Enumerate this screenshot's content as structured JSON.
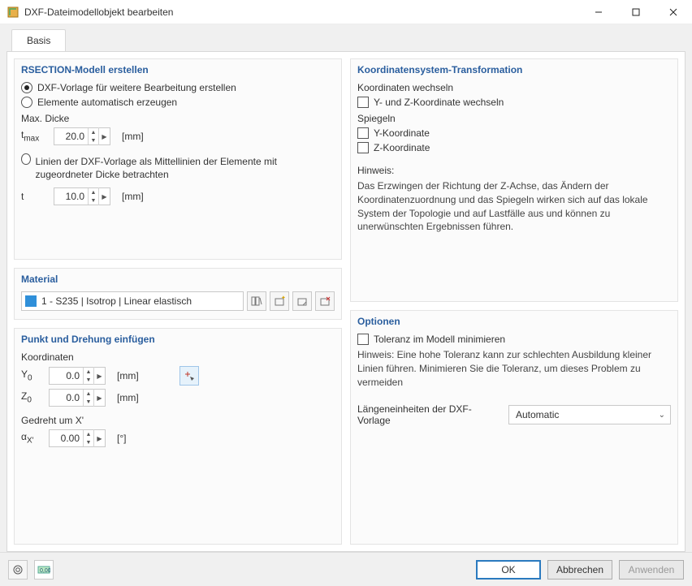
{
  "window": {
    "title": "DXF-Dateimodellobjekt bearbeiten"
  },
  "tabs": {
    "basis": "Basis"
  },
  "rsection": {
    "title": "RSECTION-Modell erstellen",
    "opt_template": "DXF-Vorlage für weitere Bearbeitung erstellen",
    "opt_auto": "Elemente automatisch erzeugen",
    "max_thickness_label": "Max. Dicke",
    "tmax_prefix": "t",
    "tmax_sub": "max",
    "tmax_value": "20.0",
    "tmax_unit": "[mm]",
    "opt_centerlines": "Linien der DXF-Vorlage als Mittellinien der Elemente mit zugeordneter Dicke betrachten",
    "t_label": "t",
    "t_value": "10.0",
    "t_unit": "[mm]"
  },
  "material": {
    "title": "Material",
    "value": "1 - S235 | Isotrop | Linear elastisch"
  },
  "insert": {
    "title": "Punkt und Drehung einfügen",
    "coord_label": "Koordinaten",
    "y0_prefix": "Y",
    "y0_sub": "0",
    "y0_value": "0.0",
    "y0_unit": "[mm]",
    "z0_prefix": "Z",
    "z0_sub": "0",
    "z0_value": "0.0",
    "z0_unit": "[mm]",
    "rot_label": "Gedreht um X'",
    "ax_prefix": "α",
    "ax_sub": "X'",
    "ax_value": "0.00",
    "ax_unit": "[°]"
  },
  "coord_trans": {
    "title": "Koordinatensystem-Transformation",
    "swap_label": "Koordinaten wechseln",
    "swap_yz": "Y- und Z-Koordinate wechseln",
    "mirror_label": "Spiegeln",
    "mirror_y": "Y-Koordinate",
    "mirror_z": "Z-Koordinate",
    "hint_label": "Hinweis:",
    "hint_text": "Das Erzwingen der Richtung der Z-Achse, das Ändern der Koordinatenzuordnung und das Spiegeln wirken sich auf das lokale System der Topologie und auf Lastfälle aus und können zu unerwünschten Ergebnissen führen."
  },
  "options": {
    "title": "Optionen",
    "min_tol": "Toleranz im Modell minimieren",
    "tol_hint": "Hinweis: Eine hohe Toleranz kann zur schlechten Ausbildung kleiner Linien führen. Minimieren Sie die Toleranz, um dieses Problem zu vermeiden",
    "len_units_label": "Längeneinheiten der DXF-Vorlage",
    "len_units_value": "Automatic"
  },
  "footer": {
    "ok": "OK",
    "cancel": "Abbrechen",
    "apply": "Anwenden"
  }
}
